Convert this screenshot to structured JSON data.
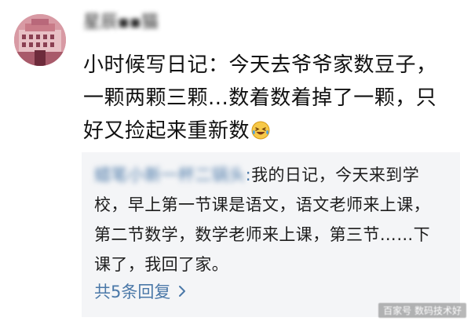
{
  "comment": {
    "author_name": "星辰▪▪猫",
    "text": "小时候写日记：今天去爷爷家数豆子，一颗两颗三颗...数着数着掉了一颗，只好又捡起来重新数",
    "emoji_icon": "laughing-crying-emoji-icon"
  },
  "reply": {
    "user_name": "蜡笔小新一杯二锅头",
    "colon": ":",
    "text": "我的日记，今天来到学校，早上第一节课是语文，语文老师来上课，第二节数学，数学老师来上课，第三节……下课了，我回了家。",
    "more_replies_label": "共5条回复",
    "chevron_icon": "chevron-right-icon"
  },
  "watermark": {
    "text": "百家号 数码技术好"
  },
  "colors": {
    "link": "#4a78a8",
    "reply_background": "#f4f5f7",
    "text": "#111111"
  }
}
